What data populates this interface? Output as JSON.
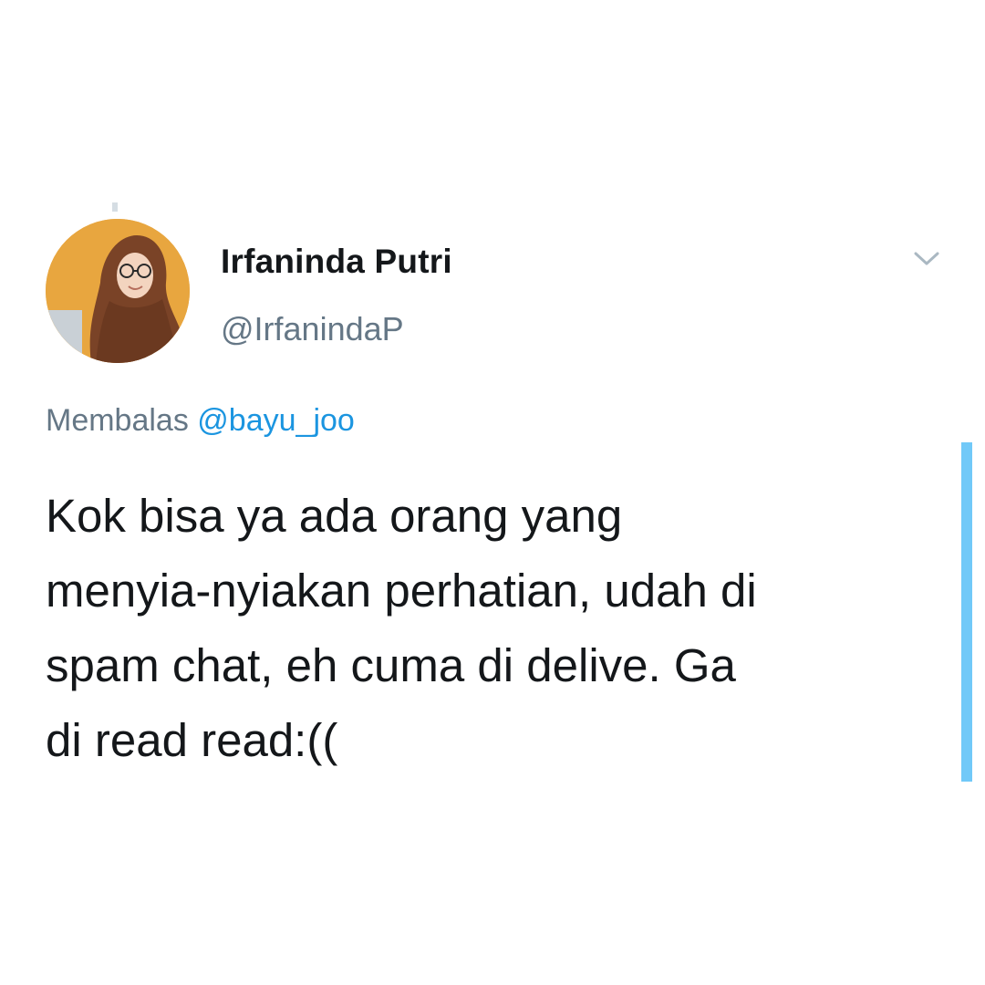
{
  "tweet": {
    "author": {
      "display_name": "Irfaninda Putri",
      "handle": "@IrfanindaP",
      "avatar_icon": "profile-photo"
    },
    "reply": {
      "prefix": "Membalas",
      "mention": "@bayu_joo"
    },
    "text_lines": [
      "Kok bisa ya ada orang yang",
      "menyia-nyiakan perhatian, udah di",
      "spam chat, eh cuma di delive. Ga",
      "di read read:(("
    ],
    "more_icon": "chevron-down-icon"
  },
  "colors": {
    "name": "#14171a",
    "secondary": "#657786",
    "mention": "#1b95e0",
    "highlight_bar": "#71c9f8",
    "avatar_bg": "#e6a23c"
  }
}
